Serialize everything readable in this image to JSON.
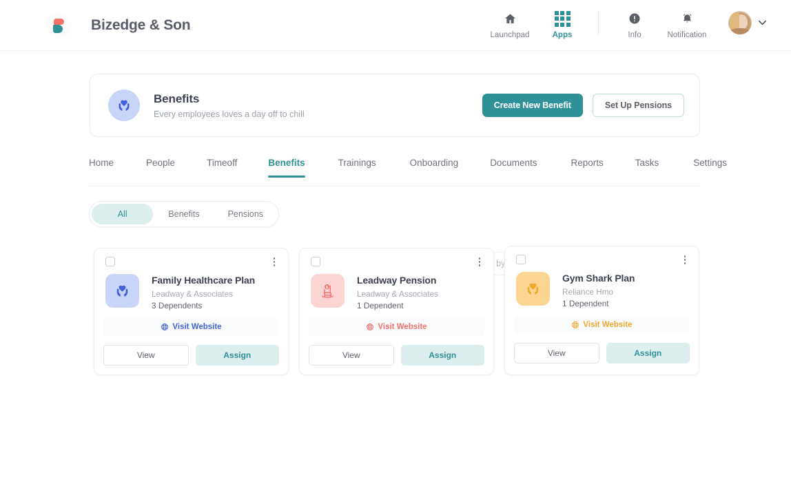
{
  "header": {
    "brand_name": "Bizedge & Son",
    "nav": [
      {
        "label": "Launchpad",
        "icon": "home-icon",
        "active": false
      },
      {
        "label": "Apps",
        "icon": "apps-grid-icon",
        "active": true
      },
      {
        "label": "Info",
        "icon": "info-icon",
        "active": false
      },
      {
        "label": "Notification",
        "icon": "bell-icon",
        "active": false
      }
    ],
    "avatar_alt": "user-avatar",
    "chevron": "⌄"
  },
  "hero": {
    "icon": "heart-in-hands-icon",
    "title": "Benefits",
    "subtitle": "Every employees loves a day off to chill",
    "primary_button": "Create New Benefit",
    "secondary_button": "Set Up Pensions"
  },
  "tabs": [
    {
      "label": "Home",
      "active": false
    },
    {
      "label": "People",
      "active": false
    },
    {
      "label": "Timeoff",
      "active": false
    },
    {
      "label": "Benefits",
      "active": true
    },
    {
      "label": "Trainings",
      "active": false
    },
    {
      "label": "Onboarding",
      "active": false
    },
    {
      "label": "Documents",
      "active": false
    },
    {
      "label": "Reports",
      "active": false
    },
    {
      "label": "Tasks",
      "active": false
    },
    {
      "label": "Settings",
      "active": false
    }
  ],
  "filters": {
    "pills": [
      {
        "label": "All",
        "active": true
      },
      {
        "label": "Benefits",
        "active": false
      },
      {
        "label": "Pensions",
        "active": false
      }
    ]
  },
  "search": {
    "placeholder": "Search by Name",
    "value": "",
    "icon": "search-icon"
  },
  "cards": [
    {
      "name": "Family Healthcare Plan",
      "provider": "Leadway & Associates",
      "dependents": "3 Dependents",
      "visit_label": "Visit Website",
      "view_label": "View",
      "assign_label": "Assign",
      "icon": "heart-in-hands-icon",
      "icon_bg": "#c9d5f8",
      "icon_color": "#4263d6",
      "accent": "#4263d6",
      "checked": false
    },
    {
      "name": "Leadway Pension",
      "provider": "Leadway & Associates",
      "dependents": "1 Dependent",
      "visit_label": "Visit Website",
      "view_label": "View",
      "assign_label": "Assign",
      "icon": "rocking-chair-coin-icon",
      "icon_bg": "#fbd4d3",
      "icon_color": "#f4706b",
      "accent": "#f4706b",
      "checked": false
    },
    {
      "name": "Gym Shark Plan",
      "provider": "Reliance Hmo",
      "dependents": "1 Dependent",
      "visit_label": "Visit Website",
      "view_label": "View",
      "assign_label": "Assign",
      "icon": "heart-in-hands-icon",
      "icon_bg": "#fbd591",
      "icon_color": "#f0a92c",
      "accent": "#f0a92c",
      "checked": false
    }
  ],
  "theme": {
    "accent": "#2f9197",
    "accent_soft": "#dceeee",
    "text_dark": "#3d4250",
    "text_muted": "#9aa0a9"
  }
}
